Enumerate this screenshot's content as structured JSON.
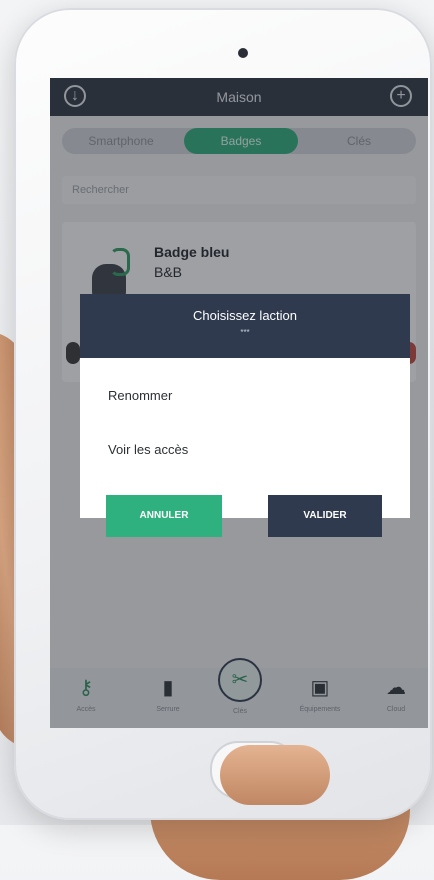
{
  "header": {
    "title": "Maison"
  },
  "segments": [
    "Smartphone",
    "Badges",
    "Clés"
  ],
  "search": {
    "placeholder": "Rechercher"
  },
  "card": {
    "name": "Badge bleu",
    "subtitle": "B&B"
  },
  "dialog": {
    "title": "Choisissez laction",
    "subtitle": "***",
    "options": [
      "Renommer",
      "Voir les accès"
    ],
    "cancel_label": "ANNULER",
    "ok_label": "VALIDER"
  },
  "tabs": [
    "Accès",
    "Serrure",
    "Clés",
    "Équipements",
    "Cloud"
  ],
  "colors": {
    "accent_green": "#2cae7c",
    "header_dark": "#2c3440",
    "dialog_dark": "#2f3a4f"
  }
}
